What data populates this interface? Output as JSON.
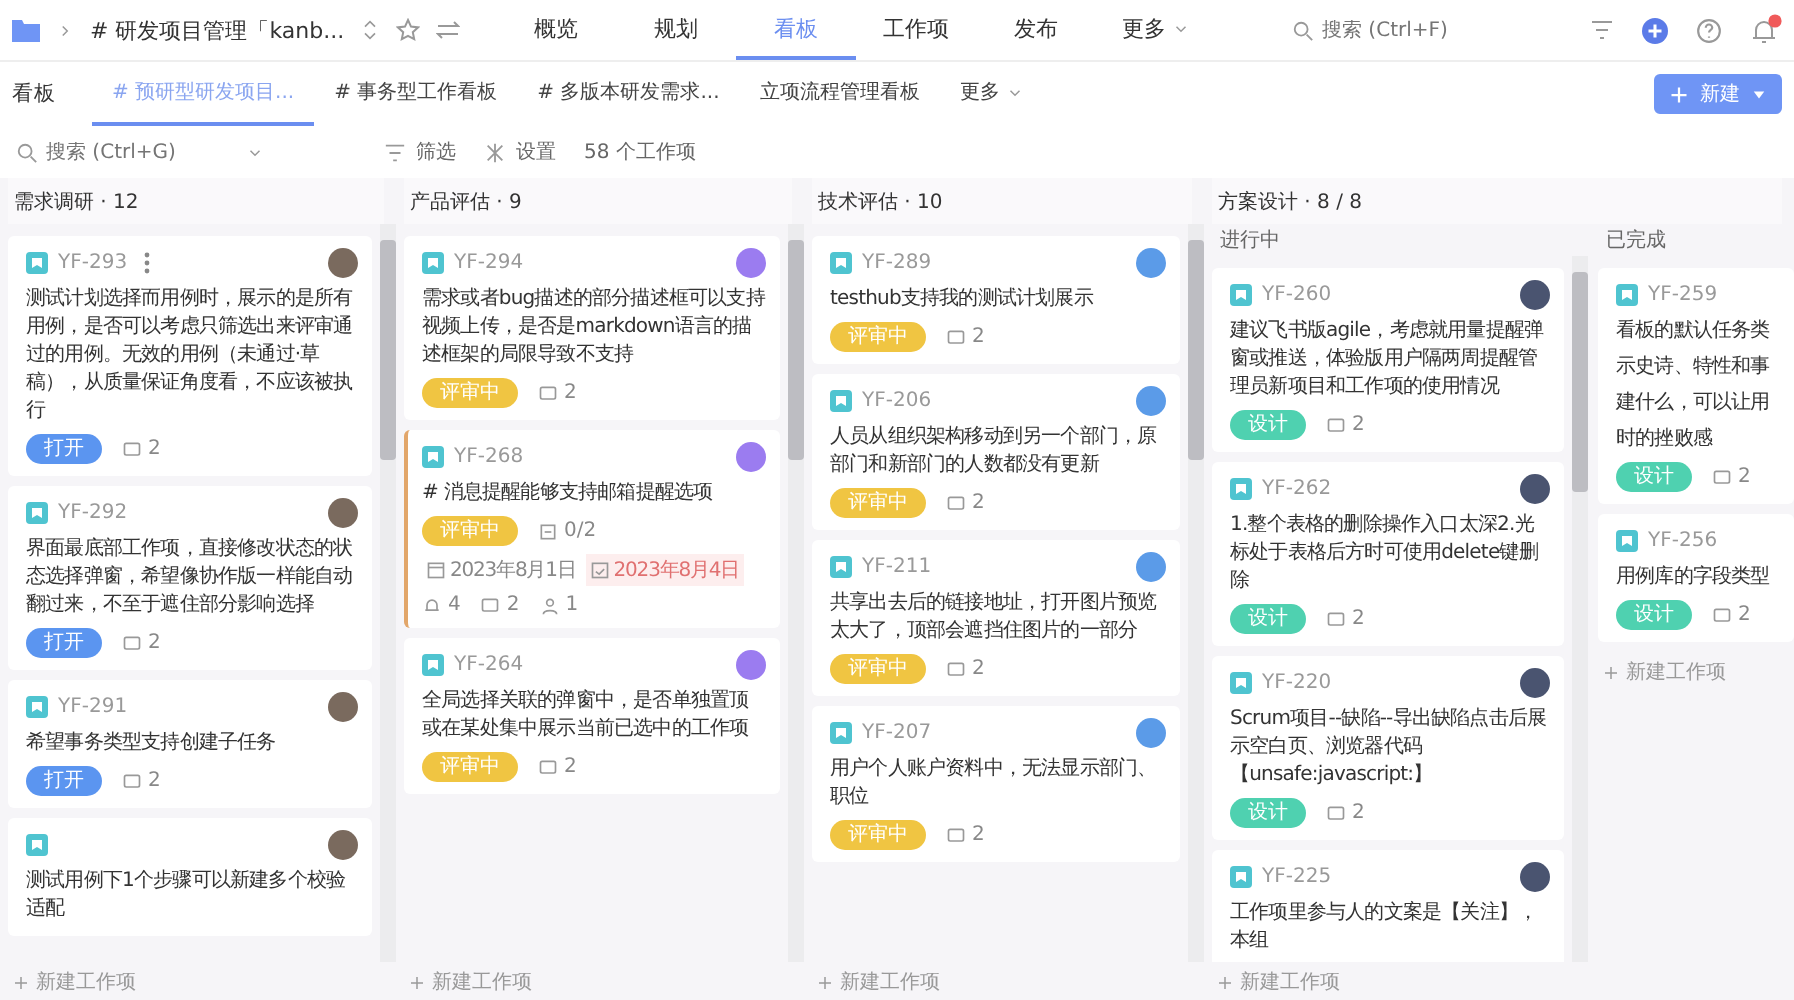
{
  "breadcrumb": {
    "title": "# 研发项目管理「kanb..."
  },
  "nav": [
    {
      "label": "概览",
      "selected": false,
      "dropdown": false
    },
    {
      "label": "规划",
      "selected": false,
      "dropdown": false
    },
    {
      "label": "看板",
      "selected": true,
      "dropdown": false
    },
    {
      "label": "工作项",
      "selected": false,
      "dropdown": false
    },
    {
      "label": "发布",
      "selected": false,
      "dropdown": false
    },
    {
      "label": "更多",
      "selected": false,
      "dropdown": true
    }
  ],
  "search": {
    "placeholder": "搜索 (Ctrl+F)"
  },
  "board_tabs_label": "看板",
  "board_tabs": [
    {
      "label": "# 预研型研发项目...",
      "selected": true
    },
    {
      "label": "# 事务型工作看板",
      "selected": false
    },
    {
      "label": "# 多版本研发需求...",
      "selected": false
    },
    {
      "label": "立项流程管理看板",
      "selected": false
    }
  ],
  "board_tabs_more": "更多",
  "new_button": "新建",
  "toolbar": {
    "search_placeholder": "搜索 (Ctrl+G)",
    "filter": "筛选",
    "settings": "设置",
    "count": "58 个工作项"
  },
  "columns": [
    {
      "title": "需求调研 · 12",
      "lanes": [
        {
          "add": "新建工作项",
          "cards": [
            {
              "id": "YF-293",
              "text": "测试计划选择而用例时，展示的是所有用例，是否可以考虑只筛选出来评审通过的用例。无效的用例（未通过·草稿），从质量保证角度看，不应该被执行",
              "status": {
                "kind": "open",
                "label": "打开"
              },
              "comments": "2",
              "selected": false,
              "hovered": true
            },
            {
              "id": "YF-292",
              "text": "界面最底部工作项，直接修改状态的状态选择弹窗，希望像协作版一样能自动翻过来，不至于遮住部分影响选择",
              "status": {
                "kind": "open",
                "label": "打开"
              },
              "comments": "2",
              "selected": false,
              "hovered": false
            },
            {
              "id": "YF-291",
              "text": "希望事务类型支持创建子任务",
              "status": {
                "kind": "open",
                "label": "打开"
              },
              "comments": "2",
              "selected": false,
              "hovered": false
            },
            {
              "text": "测试用例下1个步骤可以新建多个校验适配",
              "selected": false,
              "hovered": false
            }
          ]
        }
      ]
    },
    {
      "title": "产品评估 · 9",
      "lanes": [
        {
          "add": "新建工作项",
          "cards": [
            {
              "id": "YF-294",
              "text": "需求或者bug描述的部分描述框可以支持视频上传，是否是markdown语言的描述框架的局限导致不支持",
              "status": {
                "kind": "review",
                "label": "评审中"
              },
              "comments": "2",
              "selected": false,
              "hovered": false
            },
            {
              "id": "YF-268",
              "text": "# 消息提醒能够支持邮箱提醒选项",
              "status": {
                "kind": "review",
                "label": "评审中"
              },
              "subtasks": "0/2",
              "start": "2023年8月1日",
              "due": "2023年8月4日",
              "watchers": "4",
              "comments": "2",
              "assignees": "1",
              "selected": true,
              "hovered": false
            },
            {
              "id": "YF-264",
              "text": "全局选择关联的弹窗中，是否单独置顶或在某处集中展示当前已选中的工作项",
              "status": {
                "kind": "review",
                "label": "评审中"
              },
              "comments": "2",
              "selected": false,
              "hovered": false
            }
          ]
        }
      ]
    },
    {
      "title": "技术评估 · 10",
      "lanes": [
        {
          "add": "新建工作项",
          "cards": [
            {
              "id": "YF-289",
              "text": "testhub支持我的测试计划展示",
              "status": {
                "kind": "review",
                "label": "评审中"
              },
              "comments": "2",
              "selected": false,
              "hovered": false
            },
            {
              "id": "YF-206",
              "text": "人员从组织架构移动到另一个部门，原部门和新部门的人数都没有更新",
              "status": {
                "kind": "review",
                "label": "评审中"
              },
              "comments": "2",
              "selected": false,
              "hovered": false
            },
            {
              "id": "YF-211",
              "text": "共享出去后的链接地址，打开图片预览太大了，顶部会遮挡住图片的一部分",
              "status": {
                "kind": "review",
                "label": "评审中"
              },
              "comments": "2",
              "selected": false,
              "hovered": false
            },
            {
              "id": "YF-207",
              "text": "用户个人账户资料中，无法显示部门、职位",
              "status": {
                "kind": "review",
                "label": "评审中"
              },
              "comments": "2",
              "selected": false,
              "hovered": false
            }
          ]
        }
      ]
    },
    {
      "title": "方案设计 · 8 / 8",
      "lanes": [
        {
          "title": "进行中",
          "add": "新建工作项",
          "cards": [
            {
              "id": "YF-260",
              "text": "建议飞书版agile，考虑就用量提醒弹窗或推送，体验版用户隔两周提醒管理员新项目和工作项的使用情况",
              "status": {
                "kind": "design",
                "label": "设计"
              },
              "comments": "2",
              "selected": false,
              "hovered": false
            },
            {
              "id": "YF-262",
              "text": "1.整个表格的删除操作入口太深2.光标处于表格后方时可使用delete键删除",
              "status": {
                "kind": "design",
                "label": "设计"
              },
              "comments": "2",
              "selected": false,
              "hovered": false
            },
            {
              "id": "YF-220",
              "text": "Scrum项目--缺陷--导出缺陷点击后展示空白页、浏览器代码【unsafe:javascript:】",
              "status": {
                "kind": "design",
                "label": "设计"
              },
              "comments": "2",
              "selected": false,
              "hovered": false
            },
            {
              "id": "YF-225",
              "text": "工作项里参与人的文案是【关注】，本组",
              "selected": false,
              "hovered": false
            }
          ]
        },
        {
          "title": "已完成",
          "add": "新建工作项",
          "cards": [
            {
              "id": "YF-259",
              "lines": [
                "看板的默认任务类",
                "示史诗、特性和事",
                "建什么，可以让用",
                "时的挫败感"
              ],
              "status": {
                "kind": "design",
                "label": "设计"
              },
              "comments": "2",
              "selected": false,
              "hovered": false
            },
            {
              "id": "YF-256",
              "text": "用例库的字段类型",
              "status": {
                "kind": "design",
                "label": "设计"
              },
              "comments": "2",
              "selected": false,
              "hovered": false
            }
          ]
        }
      ]
    }
  ]
}
